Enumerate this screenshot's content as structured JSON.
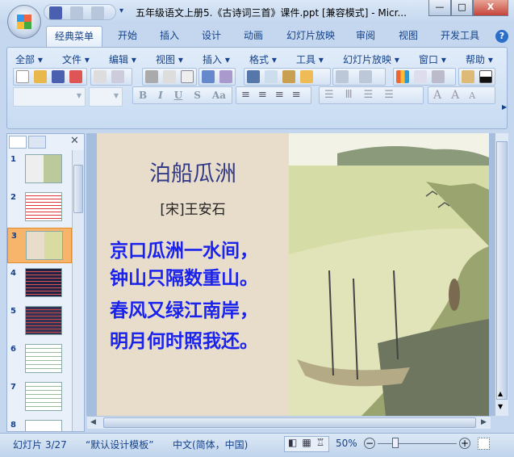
{
  "window": {
    "title": "五年级语文上册5.《古诗词三首》课件.ppt [兼容模式] - Micr...",
    "min": "—",
    "max": "□",
    "close": "X"
  },
  "tabs": [
    "经典菜单",
    "开始",
    "插入",
    "设计",
    "动画",
    "幻灯片放映",
    "审阅",
    "视图",
    "开发工具"
  ],
  "menus": [
    "全部 ▾",
    "文件 ▾",
    "编辑 ▾",
    "视图 ▾",
    "插入 ▾",
    "格式 ▾",
    "工具 ▾",
    "幻灯片放映 ▾",
    "窗口 ▾",
    "帮助 ▾"
  ],
  "format_buttons": [
    "B",
    "I",
    "U",
    "S",
    "Aa"
  ],
  "slides": [
    "1",
    "2",
    "3",
    "4",
    "5",
    "6",
    "7",
    "8"
  ],
  "selected_slide": 3,
  "slide": {
    "title": "泊船瓜洲",
    "author": "[宋]王安石",
    "lines": [
      "京口瓜洲一水间，",
      "钟山只隔数重山。",
      "春风又绿江南岸，",
      "明月何时照我还。"
    ]
  },
  "status": {
    "slide": "幻灯片 3/27",
    "theme": "“默认设计模板”",
    "language": "中文(简体，中国)",
    "zoom": "50%"
  }
}
